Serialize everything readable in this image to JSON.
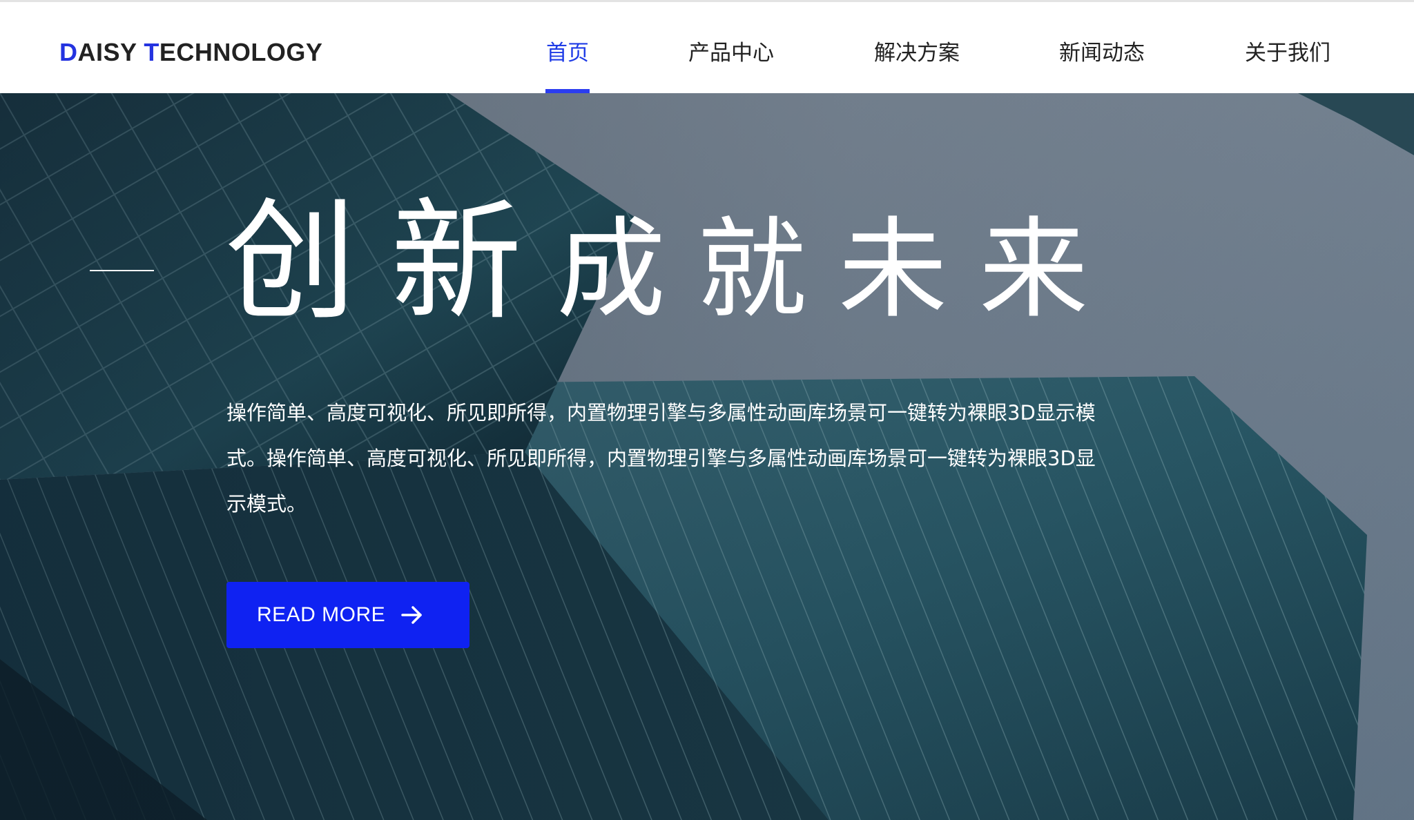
{
  "header": {
    "logo": {
      "part1_accent": "D",
      "part2": "AISY ",
      "part3_accent": "T",
      "part4": "ECHNOLOGY"
    },
    "nav": [
      {
        "label": "首页",
        "active": true
      },
      {
        "label": "产品中心",
        "active": false
      },
      {
        "label": "解决方案",
        "active": false
      },
      {
        "label": "新闻动态",
        "active": false
      },
      {
        "label": "关于我们",
        "active": false
      }
    ]
  },
  "hero": {
    "title_big": "创新",
    "title_small": "成就未来",
    "description": "操作简单、高度可视化、所见即所得，内置物理引擎与多属性动画库场景可一键转为裸眼3D显示模式。操作简单、高度可视化、所见即所得，内置物理引擎与多属性动画库场景可一键转为裸眼3D显示模式。",
    "cta_label": "READ MORE",
    "cta_icon": "arrow-right-icon",
    "background": "glass-skyscraper-photo"
  },
  "colors": {
    "accent": "#1f3ce6",
    "button": "#0f22f2",
    "text_dark": "#222222",
    "white": "#ffffff"
  }
}
